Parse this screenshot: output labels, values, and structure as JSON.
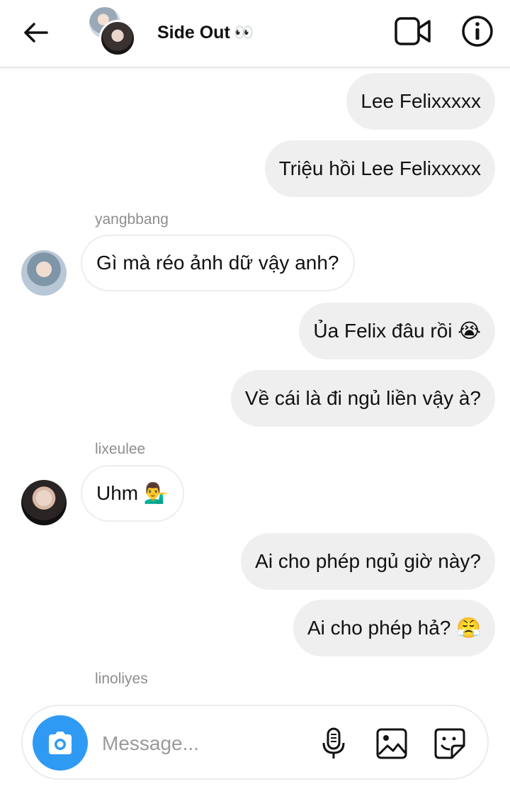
{
  "header": {
    "title": "Side Out",
    "title_emoji": "👀"
  },
  "messages": [
    {
      "type": "out",
      "text": "Lee Felixxxxx"
    },
    {
      "type": "out",
      "text": "Triệu hồi Lee Felixxxxx"
    },
    {
      "type": "sender",
      "text": "yangbbang"
    },
    {
      "type": "in",
      "text": "Gì mà réo ảnh dữ vậy anh?"
    },
    {
      "type": "out",
      "text": "Ủa Felix đâu rồi",
      "emoji": "😭"
    },
    {
      "type": "out",
      "text": "Về cái là đi ngủ liền vậy à?"
    },
    {
      "type": "sender",
      "text": "lixeulee"
    },
    {
      "type": "in",
      "text": "Uhm",
      "emoji": "💁‍♂️"
    },
    {
      "type": "out",
      "text": "Ai cho phép ngủ giờ này?"
    },
    {
      "type": "out",
      "text": "Ai cho phép hả?",
      "emoji": "😤"
    },
    {
      "type": "sender",
      "text": "linoliyes"
    }
  ],
  "composer": {
    "placeholder": "Message...",
    "icons": [
      "camera-icon",
      "microphone-icon",
      "image-icon",
      "sticker-icon"
    ]
  },
  "colors": {
    "accent": "#2f9af3",
    "outgoing_bubble": "#efefef",
    "sender_text": "#8e8e8e"
  }
}
